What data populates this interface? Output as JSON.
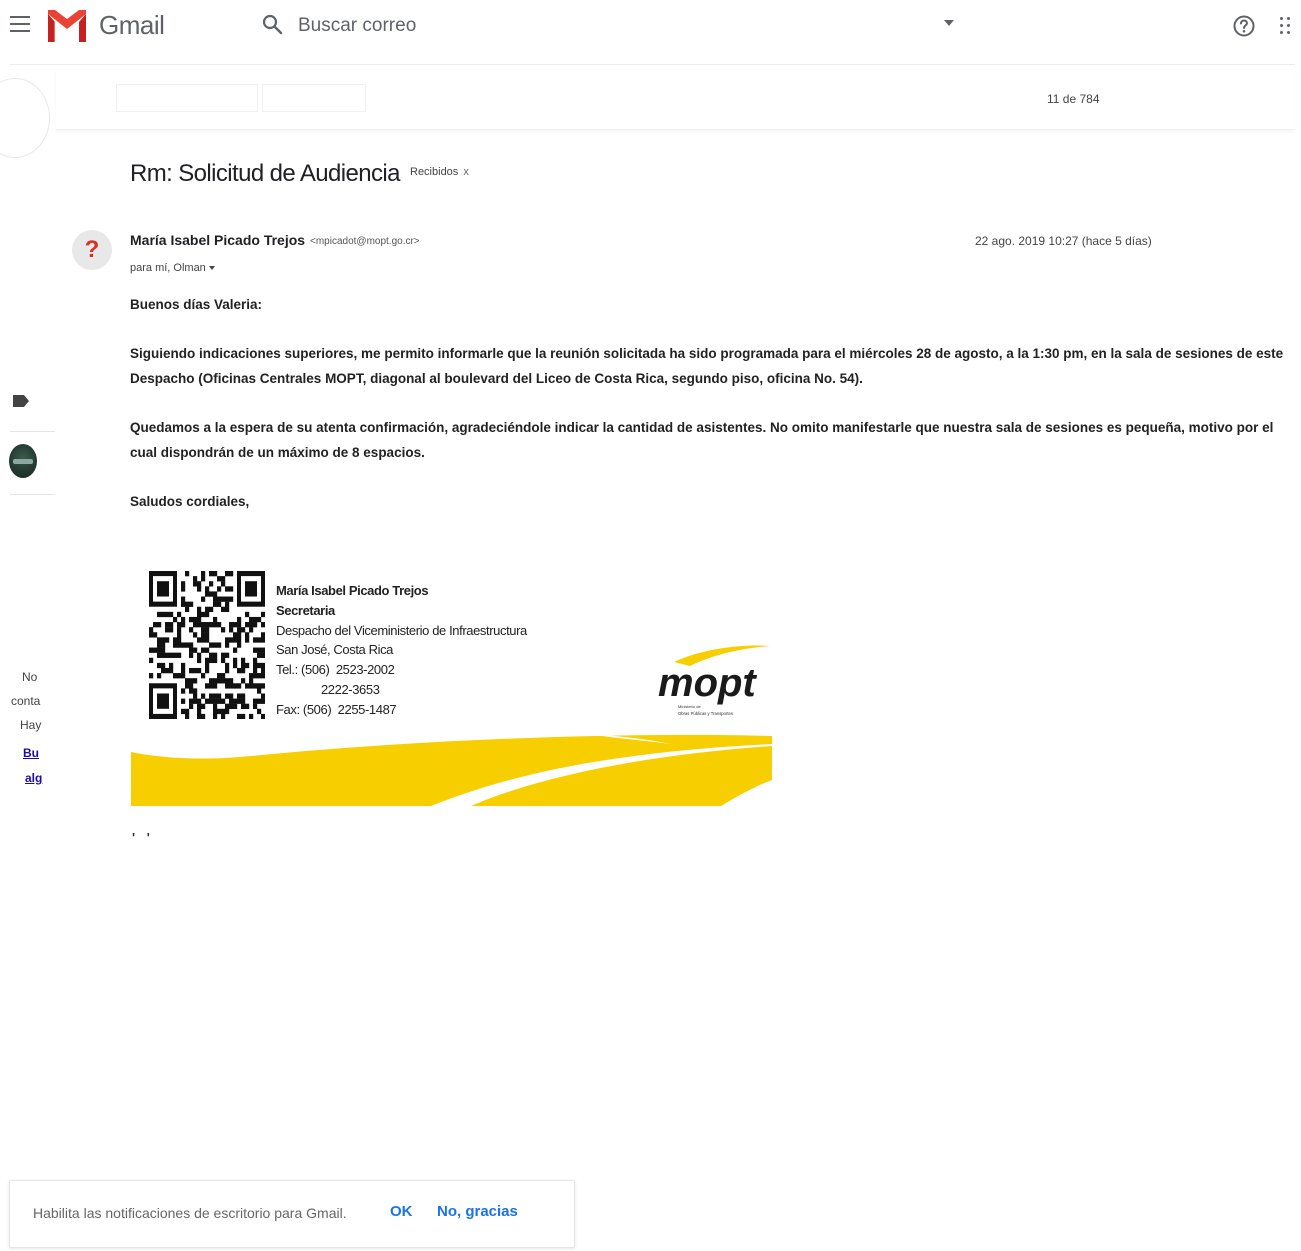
{
  "header": {
    "brand": "Gmail",
    "search_placeholder": "Buscar correo"
  },
  "toolbar": {
    "pagination": "11 de 784"
  },
  "email": {
    "subject": "Rm: Solicitud de Audiencia",
    "label": "Recibidos",
    "label_remove": "x",
    "sender_name": "María Isabel Picado Trejos",
    "sender_email": "<mpicadot@mopt.go.cr>",
    "date": "22 ago. 2019 10:27 (hace 5 días)",
    "recipients": "para mí, Olman",
    "greeting": "Buenos días Valeria:",
    "paragraph1": "Siguiendo indicaciones superiores, me permito informarle que la reunión solicitada ha sido programada para el miércoles 28 de agosto, a la 1:30 pm, en la sala de sesiones de este Despacho (Oficinas Centrales MOPT, diagonal al boulevard del Liceo de Costa Rica, segundo piso, oficina No. 54).",
    "paragraph2": "Quedamos a la espera de su atenta confirmación, agradeciéndole indicar la cantidad de asistentes.  No omito manifestarle que nuestra sala de sesiones es pequeña, motivo por el cual dispondrán de un máximo de  8 espacios.",
    "closing": "Saludos cordiales,",
    "trimmed": "' '"
  },
  "signature": {
    "name": "María Isabel Picado Trejos",
    "title": "Secretaria",
    "office": "Despacho del Viceministerio de Infraestructura",
    "location": "San José, Costa Rica",
    "tel": "Tel.: (506)  2523-2002",
    "tel2": "              2222-3653",
    "fax": "Fax: (506)  2255-1487",
    "logo_text": "mopt",
    "logo_subtext1": "Ministerio de",
    "logo_subtext2": "Obras Públicas y Transportes",
    "brand_color": "#f7cf00"
  },
  "left_rail": {
    "text1": "No",
    "text2": "conta",
    "text3": "Hay",
    "link1": "Bu",
    "link2": "alg"
  },
  "notification": {
    "text": "Habilita las notificaciones de escritorio para Gmail.",
    "ok_label": "OK",
    "no_label": "No, gracias"
  },
  "colors": {
    "gmail_red": "#d93025",
    "link_blue": "#1a73e8"
  },
  "icons": [
    "menu-icon",
    "gmail-logo",
    "search-icon",
    "chevron-down-icon",
    "help-icon",
    "apps-icon",
    "label-icon"
  ]
}
